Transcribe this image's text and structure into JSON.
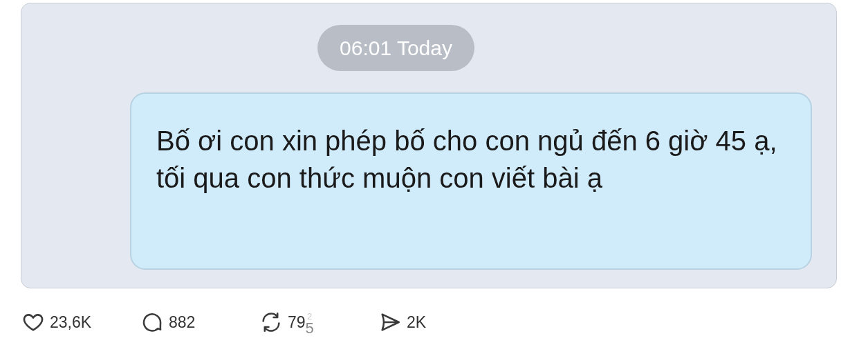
{
  "timestamp": "06:01 Today",
  "message": {
    "text": "Bố ơi con xin phép bố cho con ngủ đến 6 giờ 45 ạ, tối qua con thức muộn con viết bài ạ"
  },
  "stats": [
    {
      "kind": "like",
      "count": "23,6K"
    },
    {
      "kind": "reply",
      "count": "882"
    },
    {
      "kind": "repost",
      "count": "79",
      "rolling_upper": "2",
      "rolling_lower": "5"
    },
    {
      "kind": "share",
      "count": "2K"
    }
  ]
}
